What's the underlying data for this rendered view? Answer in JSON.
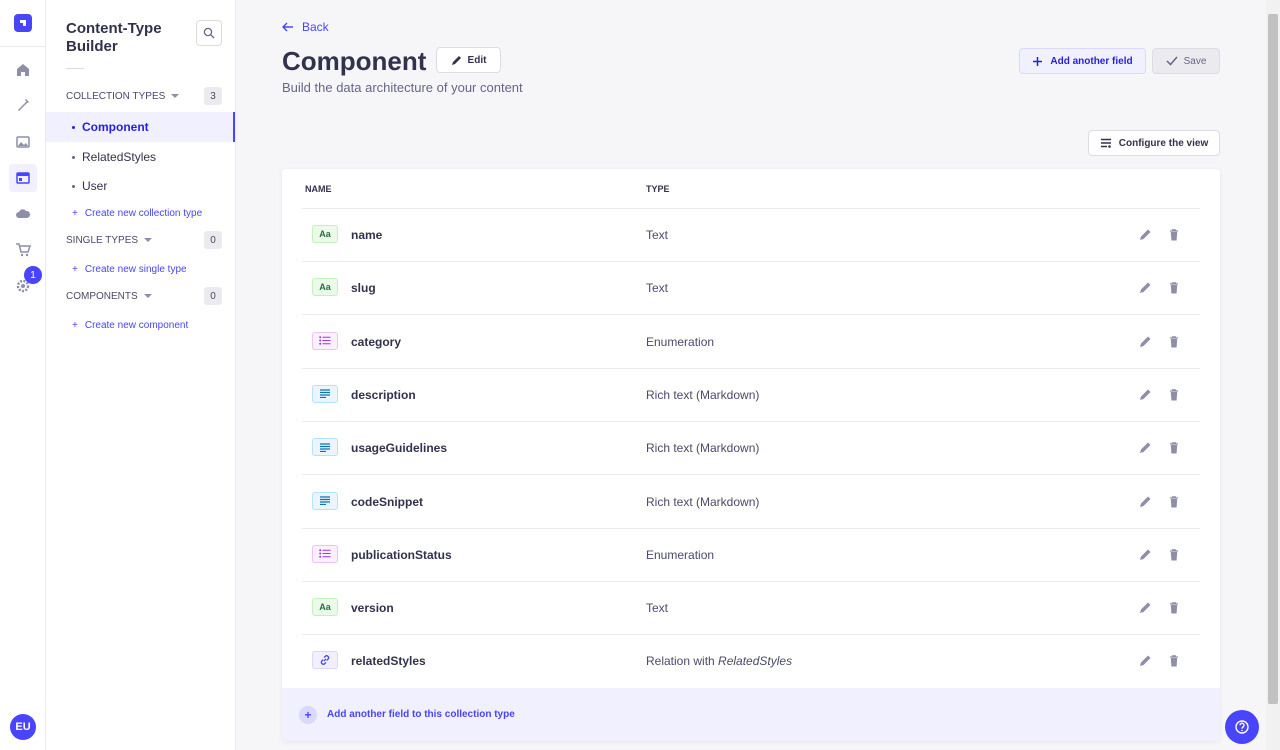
{
  "rail": {
    "notification_count": "1",
    "avatar_initials": "EU"
  },
  "subnav": {
    "title": "Content-Type Builder",
    "collection_types": {
      "label": "Collection types",
      "count": "3",
      "items": [
        "Component",
        "RelatedStyles",
        "User"
      ],
      "active": "Component",
      "create_label": "Create new collection type"
    },
    "single_types": {
      "label": "Single types",
      "count": "0",
      "create_label": "Create new single type"
    },
    "components": {
      "label": "Components",
      "count": "0",
      "create_label": "Create new component"
    }
  },
  "header": {
    "back_label": "Back",
    "title": "Component",
    "edit_label": "Edit",
    "subtitle": "Build the data architecture of your content",
    "add_field_label": "Add another field",
    "save_label": "Save",
    "configure_label": "Configure the view"
  },
  "table": {
    "columns": [
      "Name",
      "Type"
    ],
    "rows": [
      {
        "name": "name",
        "type": "Text",
        "icon": "text-field-icon",
        "kind": "text"
      },
      {
        "name": "slug",
        "type": "Text",
        "icon": "text-field-icon",
        "kind": "text"
      },
      {
        "name": "category",
        "type": "Enumeration",
        "icon": "enumeration-icon",
        "kind": "enum"
      },
      {
        "name": "description",
        "type": "Rich text (Markdown)",
        "icon": "rich-text-icon",
        "kind": "rich"
      },
      {
        "name": "usageGuidelines",
        "type": "Rich text (Markdown)",
        "icon": "rich-text-icon",
        "kind": "rich"
      },
      {
        "name": "codeSnippet",
        "type": "Rich text (Markdown)",
        "icon": "rich-text-icon",
        "kind": "rich"
      },
      {
        "name": "publicationStatus",
        "type": "Enumeration",
        "icon": "enumeration-icon",
        "kind": "enum"
      },
      {
        "name": "version",
        "type": "Text",
        "icon": "text-field-icon",
        "kind": "text"
      },
      {
        "name": "relatedStyles",
        "type_prefix": "Relation with",
        "type_target": "RelatedStyles",
        "icon": "relation-icon",
        "kind": "rel"
      }
    ],
    "text_icon_glyph": "Aa",
    "footer_label": "Add another field to this collection type"
  },
  "colors": {
    "primary": "#4945ff",
    "primary_dark": "#271fe0",
    "primary_light": "#f0f0ff"
  }
}
